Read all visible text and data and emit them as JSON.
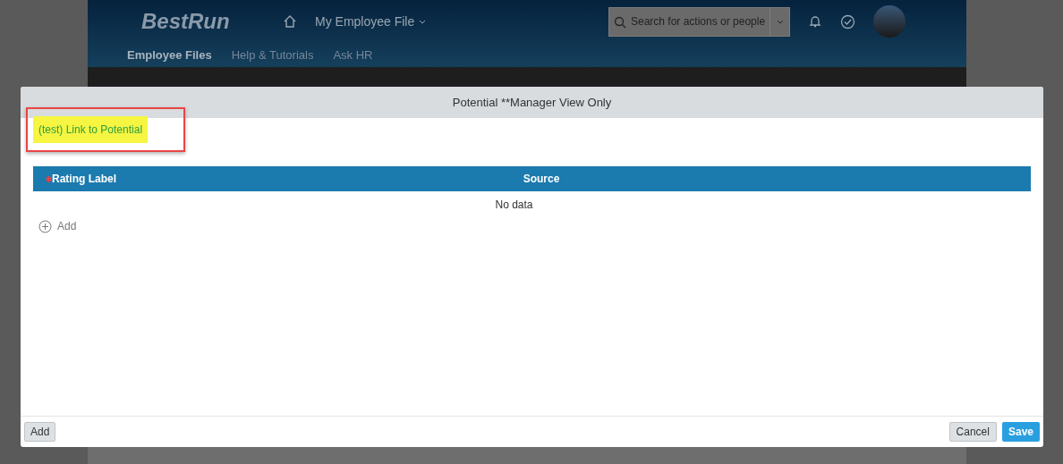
{
  "header": {
    "logo": "BestRun",
    "menu": "My Employee File",
    "search": {
      "placeholder": "Search for actions or people"
    },
    "tabs": [
      {
        "label": "Employee Files",
        "selected": true
      },
      {
        "label": "Help & Tutorials",
        "selected": false
      },
      {
        "label": "Ask HR",
        "selected": false
      }
    ]
  },
  "dialog": {
    "title": "Potential **Manager View Only",
    "link": {
      "label": "(test) Link to Potential",
      "highlighted": true
    },
    "table": {
      "columns": [
        {
          "label": "Rating Label",
          "required": true
        },
        {
          "label": "Source",
          "required": false
        }
      ],
      "empty_text": "No data"
    },
    "add_row": "Add",
    "footer": {
      "left_button": "Add",
      "buttons": [
        {
          "label": "Cancel",
          "primary": false
        },
        {
          "label": "Save",
          "primary": true
        }
      ]
    }
  }
}
